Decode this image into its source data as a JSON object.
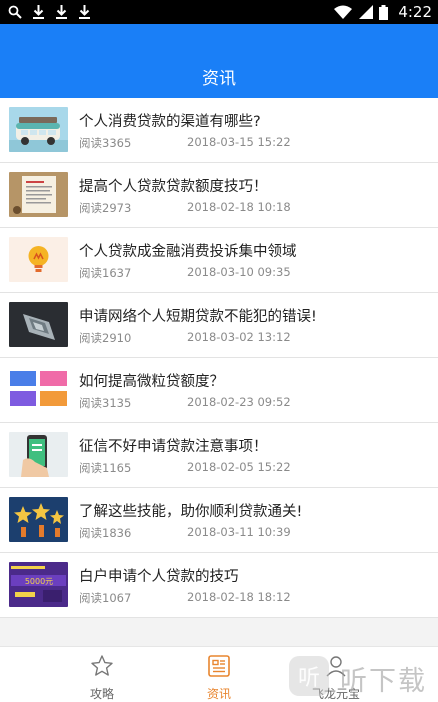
{
  "status_bar": {
    "time": "4:22"
  },
  "header": {
    "title": "资讯"
  },
  "articles": [
    {
      "title": "个人消费贷款的渠道有哪些?",
      "reads": "阅读3365",
      "date": "2018-03-15 15:22"
    },
    {
      "title": "提高个人贷款贷款额度技巧！",
      "reads": "阅读2973",
      "date": "2018-02-18 10:18"
    },
    {
      "title": "个人贷款成金融消费投诉集中领域",
      "reads": "阅读1637",
      "date": "2018-03-10 09:35"
    },
    {
      "title": "申请网络个人短期贷款不能犯的错误!",
      "reads": "阅读2910",
      "date": "2018-03-02 13:12"
    },
    {
      "title": "如何提高微粒贷额度？",
      "reads": "阅读3135",
      "date": "2018-02-23 09:52"
    },
    {
      "title": "征信不好申请贷款注意事项！",
      "reads": "阅读1165",
      "date": "2018-02-05 15:22"
    },
    {
      "title": "了解这些技能，助你顺利贷款通关!",
      "reads": "阅读1836",
      "date": "2018-03-11 10:39"
    },
    {
      "title": "白户申请个人贷款的技巧",
      "reads": "阅读1067",
      "date": "2018-02-18 18:12"
    }
  ],
  "tab_bar": {
    "tabs": [
      {
        "label": "攻略",
        "icon": "star-icon"
      },
      {
        "label": "资讯",
        "icon": "news-icon"
      },
      {
        "label": "飞龙元宝",
        "icon": "profile-icon"
      }
    ]
  },
  "thumbnail_text": {
    "amount": "5000元"
  },
  "watermark": {
    "text": "听下载"
  },
  "colors": {
    "header": "#1a7ff7",
    "active_tab": "#e8852f"
  }
}
